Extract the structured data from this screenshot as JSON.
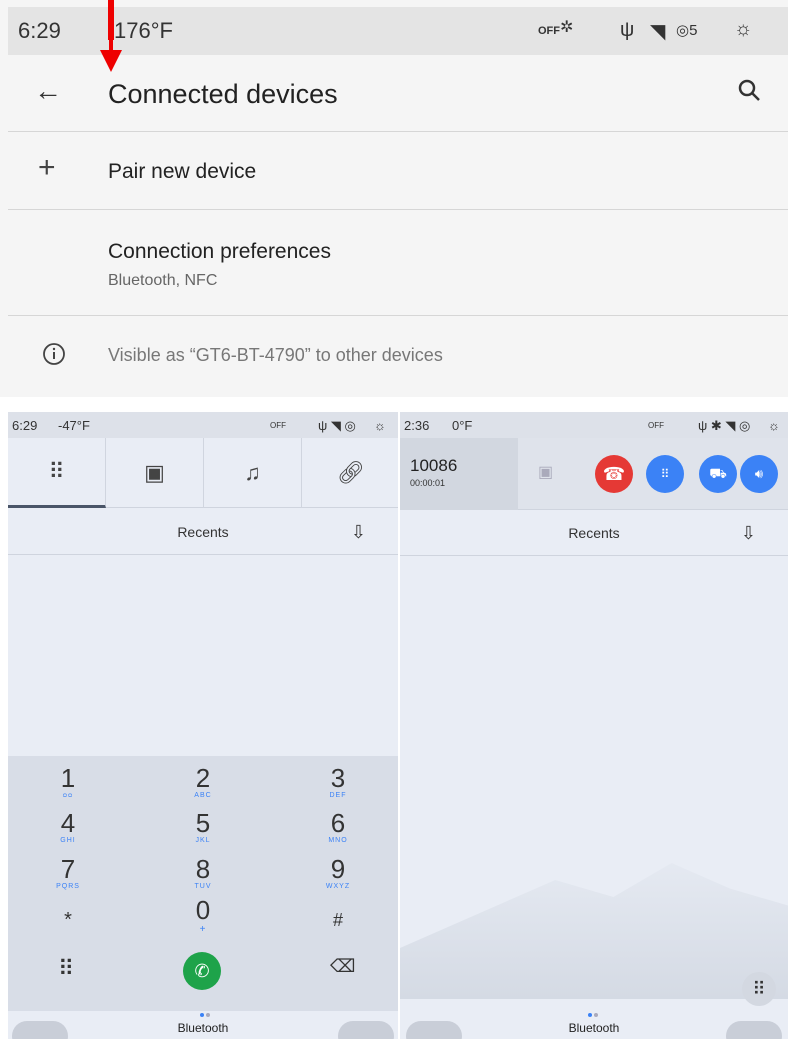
{
  "top": {
    "status": {
      "time": "6:29",
      "temp": "176°F",
      "off": "OFF"
    },
    "header": {
      "title": "Connected devices"
    },
    "items": [
      {
        "title": "Pair new device",
        "subtitle": ""
      },
      {
        "title": "Connection preferences",
        "subtitle": "Bluetooth, NFC"
      },
      {
        "title": "Visible as “GT6-BT-4790” to other devices",
        "subtitle": ""
      }
    ]
  },
  "left": {
    "status": {
      "time": "6:29",
      "temp": "-47°F",
      "off": "OFF"
    },
    "recents": "Recents",
    "keys": [
      {
        "d": "1",
        "l": "ᴑᴑ"
      },
      {
        "d": "2",
        "l": "ABC"
      },
      {
        "d": "3",
        "l": "DEF"
      },
      {
        "d": "4",
        "l": "GHI"
      },
      {
        "d": "5",
        "l": "JKL"
      },
      {
        "d": "6",
        "l": "MNO"
      },
      {
        "d": "7",
        "l": "PQRS"
      },
      {
        "d": "8",
        "l": "TUV"
      },
      {
        "d": "9",
        "l": "WXYZ"
      },
      {
        "d": "*",
        "l": ""
      },
      {
        "d": "0",
        "l": "+"
      },
      {
        "d": "#",
        "l": ""
      }
    ],
    "bottom_label": "Bluetooth"
  },
  "right": {
    "status": {
      "time": "2:36",
      "temp": "0°F",
      "off": "OFF"
    },
    "call": {
      "number": "10086",
      "duration": "00:00:01"
    },
    "recents": "Recents",
    "bottom_label": "Bluetooth"
  },
  "colors": {
    "end_call": "#e53935",
    "call_green": "#1ea34a",
    "accent_blue": "#3b82f6",
    "annotation": "#e00000"
  }
}
